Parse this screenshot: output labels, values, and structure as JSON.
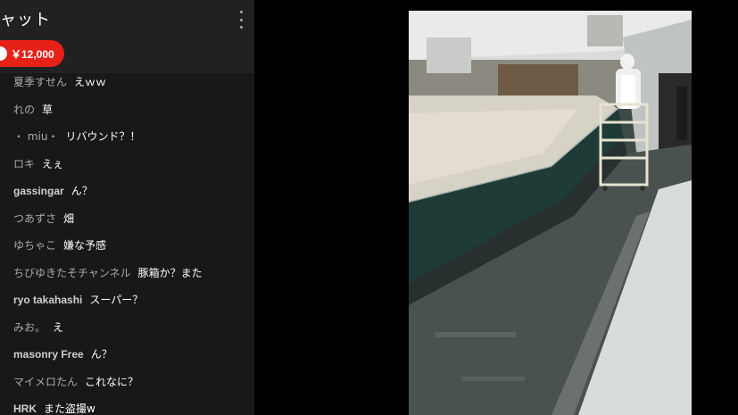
{
  "chat": {
    "title": "ャット",
    "superchat_amount": "￥12,000",
    "messages": [
      {
        "author": "夏季すせん",
        "text": "えｗｗ",
        "en": false
      },
      {
        "author": "れの",
        "text": "草",
        "en": false
      },
      {
        "author": "・ miu・",
        "text": "リバウンド？！",
        "en": false
      },
      {
        "author": "ロキ",
        "text": "えぇ",
        "en": false
      },
      {
        "author": "gassingar",
        "text": "ん？",
        "en": true
      },
      {
        "author": "つあずさ",
        "text": "畑",
        "en": false
      },
      {
        "author": "ゆちゃこ",
        "text": "嫌な予感",
        "en": false
      },
      {
        "author": "ちびゆきたそチャンネル",
        "text": "豚箱か？また",
        "en": false
      },
      {
        "author": "ryo takahashi",
        "text": "スーパー？",
        "en": true
      },
      {
        "author": "みお。",
        "text": "え",
        "en": false
      },
      {
        "author": "masonry Free",
        "text": "ん？",
        "en": true
      },
      {
        "author": "マイメロたん",
        "text": "これなに？",
        "en": false
      },
      {
        "author": "HRK",
        "text": "また盗撮w",
        "en": true
      }
    ]
  },
  "colors": {
    "chat_bg": "#181818",
    "header_bg": "#212121",
    "superchat_red": "#e62117",
    "author_gray": "#aaaaaa"
  },
  "icons": [
    "kebab-menu-icon",
    "coin-icon"
  ]
}
